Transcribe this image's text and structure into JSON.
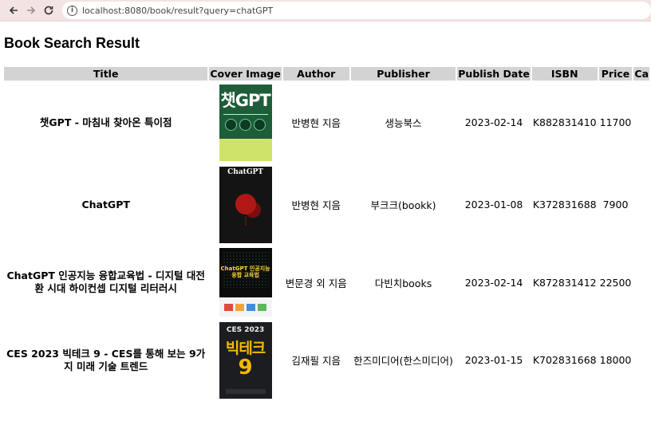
{
  "browser": {
    "back_icon": "arrow-left-icon",
    "forward_icon": "arrow-right-icon",
    "reload_icon": "reload-icon",
    "url": "localhost:8080/book/result?query=chatGPT"
  },
  "page": {
    "title": "Book Search Result"
  },
  "table": {
    "headers": {
      "title": "Title",
      "cover": "Cover Image",
      "author": "Author",
      "publisher": "Publisher",
      "date": "Publish Date",
      "isbn": "ISBN",
      "price": "Price",
      "extra": "Ca"
    },
    "rows": [
      {
        "title": "챗GPT - 마침내 찾아온 특이점",
        "cover_text": "챗GPT",
        "author": "반병현 지음",
        "publisher": "생능북스",
        "date": "2023-02-14",
        "isbn": "K882831410",
        "price": "11700"
      },
      {
        "title": "ChatGPT",
        "cover_text": "ChatGPT",
        "author": "반병현 지음",
        "publisher": "부크크(bookk)",
        "date": "2023-01-08",
        "isbn": "K372831688",
        "price": "7900"
      },
      {
        "title": "ChatGPT 인공지능 융합교육법 - 디지털 대전환 시대 하이컨셉 디지털 리터러시",
        "cover_text": "ChatGPT 인공지능 융합 교육법",
        "author": "변문경 외 지음",
        "publisher": "다빈치books",
        "date": "2023-02-14",
        "isbn": "K872831412",
        "price": "22500"
      },
      {
        "title": "CES 2023 빅테크 9 - CES를 통해 보는 9가지 미래 기술 트렌드",
        "cover_text": "CES 2023",
        "cover_text_big": "빅테크",
        "cover_text_num": "9",
        "author": "김재필 지음",
        "publisher": "한즈미디어(한스미디어)",
        "date": "2023-01-15",
        "isbn": "K702831668",
        "price": "18000"
      }
    ]
  }
}
